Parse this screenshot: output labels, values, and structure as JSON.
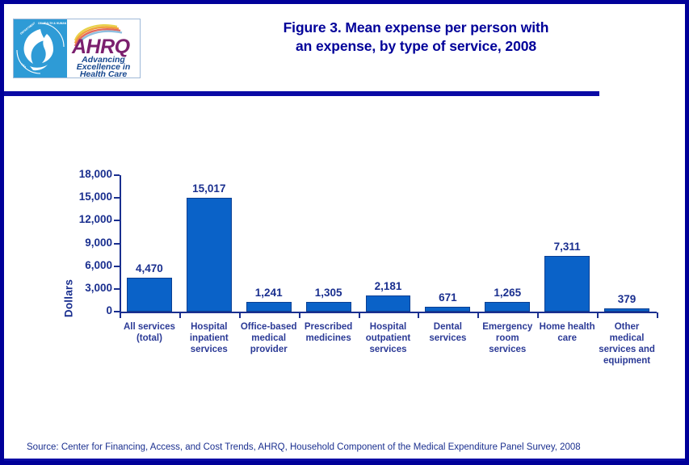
{
  "header": {
    "title_line1": "Figure 3. Mean expense per person with",
    "title_line2": "an expense, by type of service, 2008",
    "logo": {
      "agency_mark": "hhs-seal",
      "brand": "AHRQ",
      "tagline_line1": "Advancing",
      "tagline_line2": "Excellence in",
      "tagline_line3": "Health Care"
    }
  },
  "footer": {
    "source": "Source: Center for Financing, Access, and Cost Trends, AHRQ, Household Component of the Medical Expenditure Panel Survey, 2008"
  },
  "colors": {
    "border": "#000099",
    "title": "#000099",
    "rule": "#0a0aa5",
    "bar_fill": "#0a62c8",
    "bar_stroke": "#0a3f93",
    "axis": "#1a2f8f",
    "label": "#2b3a96"
  },
  "chart_data": {
    "type": "bar",
    "title": "Figure 3. Mean expense per person with an expense, by type of service, 2008",
    "xlabel": "",
    "ylabel": "Dollars",
    "ylim": [
      0,
      18000
    ],
    "yticks": [
      0,
      3000,
      6000,
      9000,
      12000,
      15000,
      18000
    ],
    "ytick_labels": [
      "0",
      "3,000",
      "6,000",
      "9,000",
      "12,000",
      "15,000",
      "18,000"
    ],
    "grid": false,
    "legend": null,
    "categories": [
      "All services (total)",
      "Hospital inpatient services",
      "Office-based medical provider",
      "Prescribed medicines",
      "Hospital outpatient services",
      "Dental services",
      "Emergency room services",
      "Home health care",
      "Other medical services and equipment"
    ],
    "category_lines": [
      [
        "All services",
        "(total)"
      ],
      [
        "Hospital",
        "inpatient",
        "services"
      ],
      [
        "Office-based",
        "medical",
        "provider"
      ],
      [
        "Prescribed",
        "medicines"
      ],
      [
        "Hospital",
        "outpatient",
        "services"
      ],
      [
        "Dental",
        "services"
      ],
      [
        "Emergency",
        "room",
        "services"
      ],
      [
        "Home health",
        "care"
      ],
      [
        "Other",
        "medical",
        "services and",
        "equipment"
      ]
    ],
    "values": [
      4470,
      15017,
      1241,
      1305,
      2181,
      671,
      1265,
      7311,
      379
    ],
    "value_labels": [
      "4,470",
      "15,017",
      "1,241",
      "1,305",
      "2,181",
      "671",
      "1,265",
      "7,311",
      "379"
    ]
  }
}
